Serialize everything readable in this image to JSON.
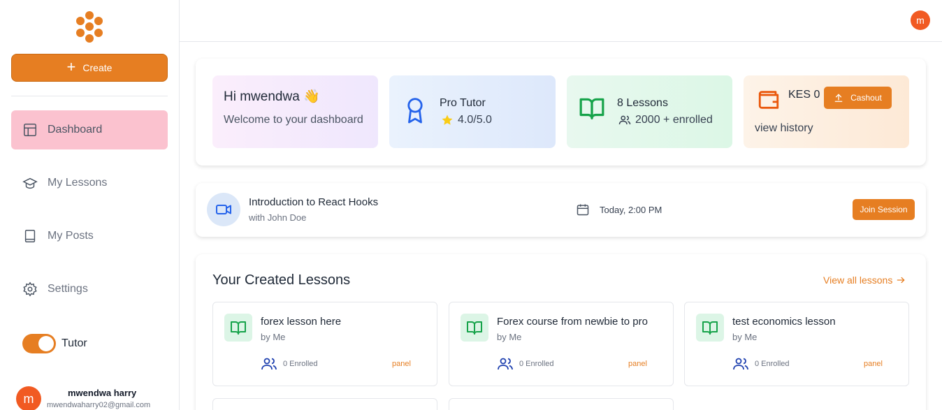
{
  "sidebar": {
    "create_label": "Create",
    "items": [
      {
        "label": "Dashboard",
        "icon": "layout-icon",
        "active": true
      },
      {
        "label": "My Lessons",
        "icon": "graduation-cap-icon"
      },
      {
        "label": "My Posts",
        "icon": "book-icon"
      },
      {
        "label": "Settings",
        "icon": "gear-icon"
      }
    ],
    "toggle_label": "Tutor",
    "user": {
      "initial": "m",
      "name": "mwendwa harry",
      "email": "mwendwaharry02@gmail.com"
    }
  },
  "topbar": {
    "avatar_initial": "m"
  },
  "stats": {
    "greeting": "Hi mwendwa 👋",
    "welcome": "Welcome to your dashboard",
    "rank_title": "Pro Tutor",
    "rating": "4.0/5.0",
    "lessons_title": "8 Lessons",
    "enrolled": "2000 + enrolled",
    "balance": "KES 0",
    "cashout_label": "Cashout",
    "history_label": "view history"
  },
  "session": {
    "title": "Introduction to React Hooks",
    "host": "with John Doe",
    "time": "Today, 2:00 PM",
    "join_label": "Join Session"
  },
  "lessons": {
    "heading": "Your Created Lessons",
    "view_all": "View all lessons",
    "items": [
      {
        "name": "forex lesson here",
        "by": "by Me",
        "enrolled": "0 Enrolled",
        "action": "panel"
      },
      {
        "name": "Forex course from newbie to pro",
        "by": "by Me",
        "enrolled": "0 Enrolled",
        "action": "panel"
      },
      {
        "name": "test economics lesson",
        "by": "by Me",
        "enrolled": "0 Enrolled",
        "action": "panel"
      }
    ]
  },
  "colors": {
    "accent": "#e67e22",
    "active_nav": "#fbc2cf",
    "avatar": "#f15a22"
  }
}
